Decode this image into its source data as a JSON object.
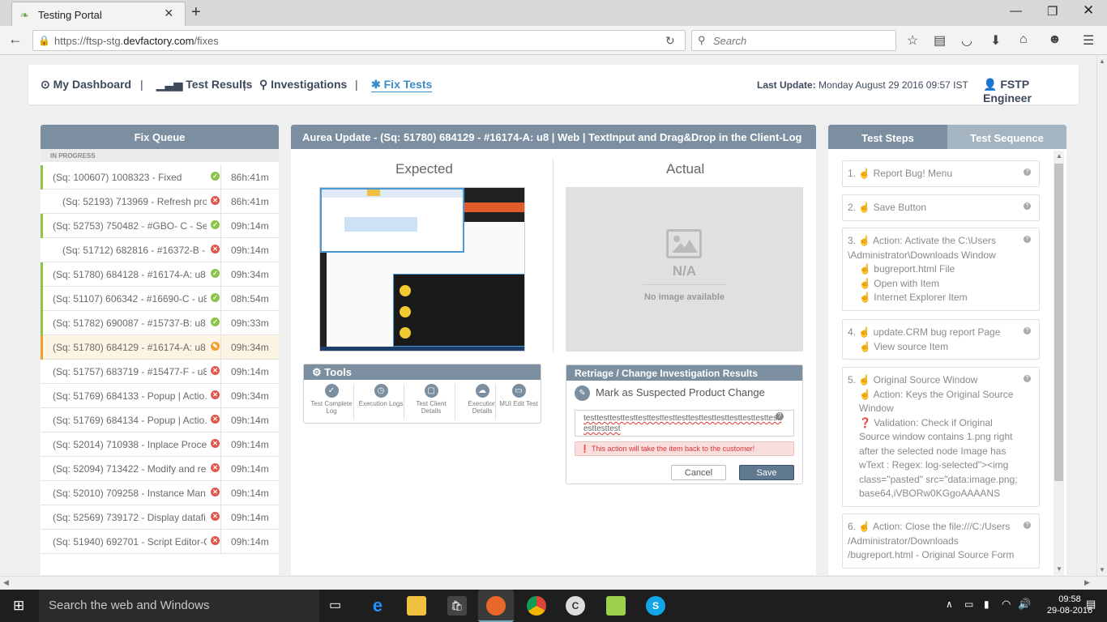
{
  "browser": {
    "tab_title": "Testing Portal",
    "url_prefix": "https://ftsp-stg.",
    "url_domain": "devfactory.com",
    "url_path": "/fixes",
    "search_placeholder": "Search"
  },
  "nav": {
    "dashboard": "My Dashboard",
    "test_results": "Test Results",
    "investigations": "Investigations",
    "fix_tests": "Fix Tests",
    "separator": "|",
    "last_update_label": "Last Update:",
    "last_update_value": "Monday August 29 2016 09:57 IST",
    "user": "FSTP Engineer"
  },
  "fix_queue": {
    "title": "Fix Queue",
    "section_label": "IN PROGRESS",
    "rows": [
      {
        "text": "(Sq: 100607) 1008323 - Fixed",
        "time": "86h:41m",
        "status": "ok"
      },
      {
        "text": "(Sq: 52193) 713969 - Refresh pro...",
        "time": "86h:41m",
        "status": "fail"
      },
      {
        "text": "(Sq: 52753) 750482 - #GBO- C - Sea...",
        "time": "09h:14m",
        "status": "ok"
      },
      {
        "text": "(Sq: 51712) 682816 - #16372-B - ...",
        "time": "09h:14m",
        "status": "fail"
      },
      {
        "text": "(Sq: 51780) 684128 - #16174-A: u8 ...",
        "time": "09h:34m",
        "status": "ok"
      },
      {
        "text": "(Sq: 51107) 606342 - #16690-C - u8...",
        "time": "08h:54m",
        "status": "ok"
      },
      {
        "text": "(Sq: 51782) 690087 - #15737-B: u8 ...",
        "time": "09h:33m",
        "status": "ok"
      },
      {
        "text": "(Sq: 51780) 684129 - #16174-A: u8 ...",
        "time": "09h:34m",
        "status": "edit"
      },
      {
        "text": "(Sq: 51757) 683719 - #15477-F - u8 ...",
        "time": "09h:14m",
        "status": "fail"
      },
      {
        "text": "(Sq: 51769) 684133 - Popup | Actio...",
        "time": "09h:34m",
        "status": "fail"
      },
      {
        "text": "(Sq: 51769) 684134 - Popup | Actio...",
        "time": "09h:14m",
        "status": "fail"
      },
      {
        "text": "(Sq: 52014) 710938 - Inplace Proce...",
        "time": "09h:14m",
        "status": "fail"
      },
      {
        "text": "(Sq: 52094) 713422 - Modify and re...",
        "time": "09h:14m",
        "status": "fail"
      },
      {
        "text": "(Sq: 52010) 709258 - Instance Man...",
        "time": "09h:14m",
        "status": "fail"
      },
      {
        "text": "(Sq: 52569) 739172 - Display datafi...",
        "time": "09h:14m",
        "status": "fail"
      },
      {
        "text": "(Sq: 51940) 692701 - Script Editor-G...",
        "time": "09h:14m",
        "status": "fail"
      }
    ]
  },
  "detail": {
    "title": "Aurea Update - (Sq: 51780) 684129 - #16174-A: u8 | Web | TextInput and Drag&Drop in the Client-Log",
    "expected_label": "Expected",
    "actual_label": "Actual",
    "na_label": "N/A",
    "no_image_label": "No image available",
    "tools_title": "Tools",
    "tools": [
      {
        "label": "Test Complete Log",
        "icon": "check-icon"
      },
      {
        "label": "Execution Logs",
        "icon": "clock-icon"
      },
      {
        "label": "Test Client Details",
        "icon": "window-icon"
      },
      {
        "label": "Execution Details",
        "icon": "cloud-icon"
      },
      {
        "label": "MUI Edit Test",
        "icon": "monitor-icon"
      }
    ],
    "retriage_title": "Retriage / Change Investigation Results",
    "mark_label": "Mark as Suspected Product Change",
    "comment_text": "testtesttesttesttesttesttesttesttesttesttesttesttesttesttesttesttesttest",
    "warning": "This action will take the item back to the customer!",
    "cancel": "Cancel",
    "save": "Save"
  },
  "steps_panel": {
    "tab_steps": "Test Steps",
    "tab_sequence": "Test Sequence",
    "steps": [
      {
        "lines": [
          "1. ☝ Report Bug! Menu"
        ]
      },
      {
        "lines": [
          "2. ☝ Save Button"
        ]
      },
      {
        "lines": [
          "3. ☝ Action: Activate the C:\\Users \\Administrator\\Downloads Window",
          "☝ bugreport.html File",
          "☝ Open with Item",
          "☝ Internet Explorer Item"
        ]
      },
      {
        "lines": [
          "4. ☝ update.CRM bug report Page",
          "☝ View source Item"
        ]
      },
      {
        "lines": [
          "5. ☝ Original Source Window",
          "☝ Action: Keys the Original Source Window",
          "❓ Validation: Check if Original Source window contains 1.png right after the selected node Image has wText : Regex: log-selected\"><img class=\"pasted\" src=\"data:image.png; base64,iVBORw0KGgoAAAANS"
        ]
      },
      {
        "lines": [
          "6. ☝ Action: Close the file:///C:/Users /Administrator/Downloads /bugreport.html - Original Source Form"
        ]
      }
    ]
  },
  "taskbar": {
    "search": "Search the web and Windows",
    "time": "09:58",
    "date": "29-08-2016"
  },
  "colors": {
    "panel_header": "#7b8fa0",
    "ok": "#8cc34a",
    "fail": "#e2574c",
    "edit": "#f0a030"
  }
}
